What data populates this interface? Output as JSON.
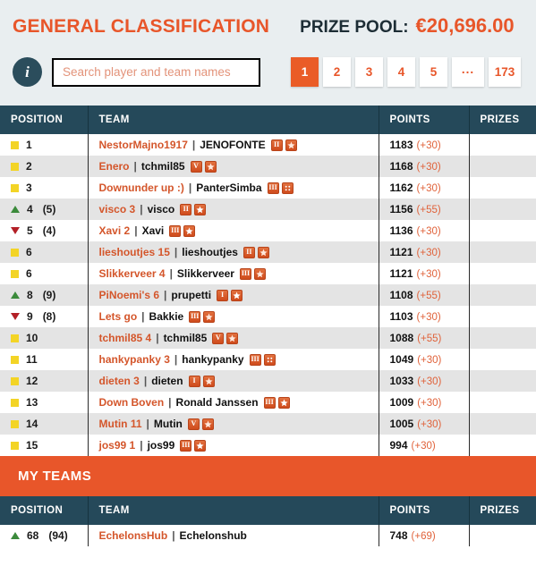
{
  "header": {
    "title": "GENERAL CLASSIFICATION",
    "prize_label": "PRIZE POOL:",
    "prize_amount": "€20,696.00",
    "info_icon_glyph": "i"
  },
  "search": {
    "placeholder": "Search player and team names",
    "value": ""
  },
  "pagination": {
    "pages": [
      "1",
      "2",
      "3",
      "4",
      "5",
      "...",
      "173"
    ],
    "active": "1"
  },
  "colors": {
    "accent_orange": "#e8562a",
    "header_teal": "#25495a",
    "panel_bg": "#e9eef0",
    "marker_same": "#f3d426",
    "marker_up": "#3b8a3b",
    "marker_down": "#b31f26",
    "team_name": "#d4562b",
    "points_delta": "#e0623a"
  },
  "table": {
    "columns": [
      "POSITION",
      "TEAM",
      "POINTS",
      "PRIZES"
    ],
    "rows": [
      {
        "marker": "same",
        "position": "1",
        "previous": "",
        "team": "NestorMajno1917",
        "user": "JENOFONTE",
        "badges": [
          "II",
          "star-dark"
        ],
        "points": "1183",
        "delta": "(+30)",
        "prize": ""
      },
      {
        "marker": "same",
        "position": "2",
        "previous": "",
        "team": "Enero",
        "user": "tchmil85",
        "badges": [
          "V",
          "star-dark"
        ],
        "points": "1168",
        "delta": "(+30)",
        "prize": ""
      },
      {
        "marker": "same",
        "position": "3",
        "previous": "",
        "team": "Downunder up :)",
        "user": "PanterSimba",
        "badges": [
          "III",
          "dice"
        ],
        "points": "1162",
        "delta": "(+30)",
        "prize": ""
      },
      {
        "marker": "up",
        "position": "4",
        "previous": "(5)",
        "team": "visco 3",
        "user": "visco",
        "badges": [
          "II",
          "star"
        ],
        "points": "1156",
        "delta": "(+55)",
        "prize": ""
      },
      {
        "marker": "down",
        "position": "5",
        "previous": "(4)",
        "team": "Xavi 2",
        "user": "Xavi",
        "badges": [
          "III",
          "star"
        ],
        "points": "1136",
        "delta": "(+30)",
        "prize": ""
      },
      {
        "marker": "same",
        "position": "6",
        "previous": "",
        "team": "lieshoutjes 15",
        "user": "lieshoutjes",
        "badges": [
          "II",
          "star-dark"
        ],
        "points": "1121",
        "delta": "(+30)",
        "prize": ""
      },
      {
        "marker": "same",
        "position": "6",
        "previous": "",
        "team": "Slikkerveer 4",
        "user": "Slikkerveer",
        "badges": [
          "III",
          "star-dark"
        ],
        "points": "1121",
        "delta": "(+30)",
        "prize": ""
      },
      {
        "marker": "up",
        "position": "8",
        "previous": "(9)",
        "team": "PiNoemi's 6",
        "user": "prupetti",
        "badges": [
          "I",
          "star"
        ],
        "points": "1108",
        "delta": "(+55)",
        "prize": ""
      },
      {
        "marker": "down",
        "position": "9",
        "previous": "(8)",
        "team": "Lets go",
        "user": "Bakkie",
        "badges": [
          "III",
          "star-dark"
        ],
        "points": "1103",
        "delta": "(+30)",
        "prize": ""
      },
      {
        "marker": "same",
        "position": "10",
        "previous": "",
        "team": "tchmil85 4",
        "user": "tchmil85",
        "badges": [
          "V",
          "star-dark"
        ],
        "points": "1088",
        "delta": "(+55)",
        "prize": ""
      },
      {
        "marker": "same",
        "position": "11",
        "previous": "",
        "team": "hankypanky 3",
        "user": "hankypanky",
        "badges": [
          "III",
          "dice"
        ],
        "points": "1049",
        "delta": "(+30)",
        "prize": ""
      },
      {
        "marker": "same",
        "position": "12",
        "previous": "",
        "team": "dieten 3",
        "user": "dieten",
        "badges": [
          "I",
          "star-dark"
        ],
        "points": "1033",
        "delta": "(+30)",
        "prize": ""
      },
      {
        "marker": "same",
        "position": "13",
        "previous": "",
        "team": "Down Boven",
        "user": "Ronald Janssen",
        "badges": [
          "III",
          "star"
        ],
        "points": "1009",
        "delta": "(+30)",
        "prize": ""
      },
      {
        "marker": "same",
        "position": "14",
        "previous": "",
        "team": "Mutin 11",
        "user": "Mutin",
        "badges": [
          "V",
          "star-dark"
        ],
        "points": "1005",
        "delta": "(+30)",
        "prize": ""
      },
      {
        "marker": "same",
        "position": "15",
        "previous": "",
        "team": "jos99 1",
        "user": "jos99",
        "badges": [
          "III",
          "star"
        ],
        "points": "994",
        "delta": "(+30)",
        "prize": ""
      }
    ]
  },
  "my_teams": {
    "banner": "MY TEAMS",
    "columns": [
      "POSITION",
      "TEAM",
      "POINTS",
      "PRIZES"
    ],
    "rows": [
      {
        "marker": "up",
        "position": "68",
        "previous": "(94)",
        "team": "EchelonsHub",
        "user": "Echelonshub",
        "badges": [],
        "points": "748",
        "delta": "(+69)",
        "prize": ""
      }
    ]
  }
}
